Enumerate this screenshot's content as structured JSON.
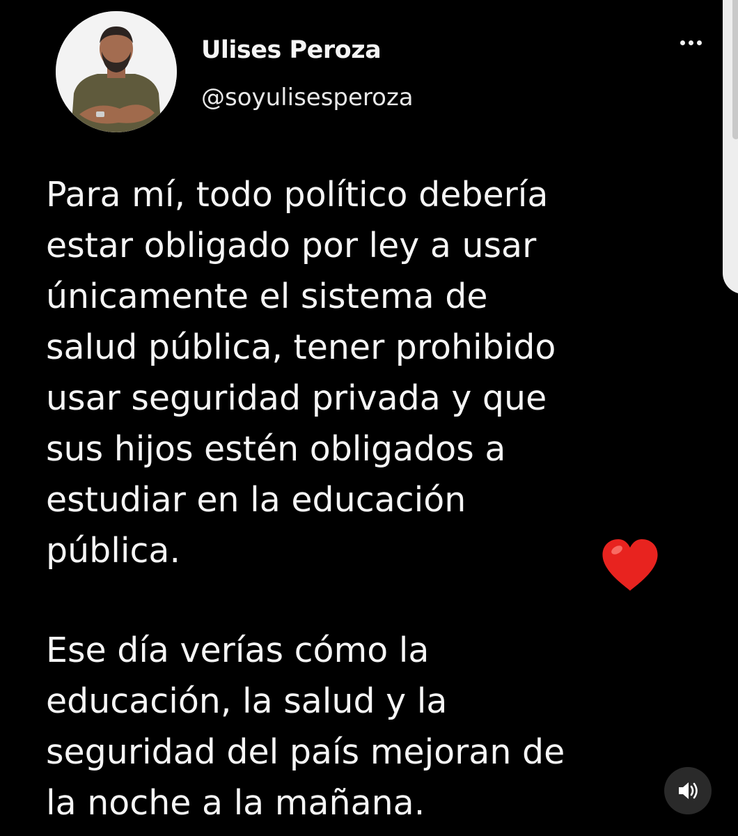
{
  "author": {
    "display_name": "Ulises Peroza",
    "handle": "@soyulisesperoza"
  },
  "tweet": {
    "paragraph_1": [
      "Para mí, todo político debería",
      "estar obligado por ley a usar",
      "únicamente el sistema de",
      "salud pública, tener prohibido",
      "usar seguridad privada y que",
      "sus hijos estén obligados a",
      "estudiar en la educación",
      "pública."
    ],
    "paragraph_2": [
      "Ese día verías cómo la",
      "educación, la salud y la",
      "seguridad del país mejoran de",
      "la noche a la mañana."
    ]
  },
  "icons": {
    "more": "more-options-icon",
    "heart": "red-heart-emoji-icon",
    "sound": "speaker-icon"
  },
  "colors": {
    "background": "#000000",
    "text": "#f5f5f5",
    "heart": "#e8231f"
  }
}
